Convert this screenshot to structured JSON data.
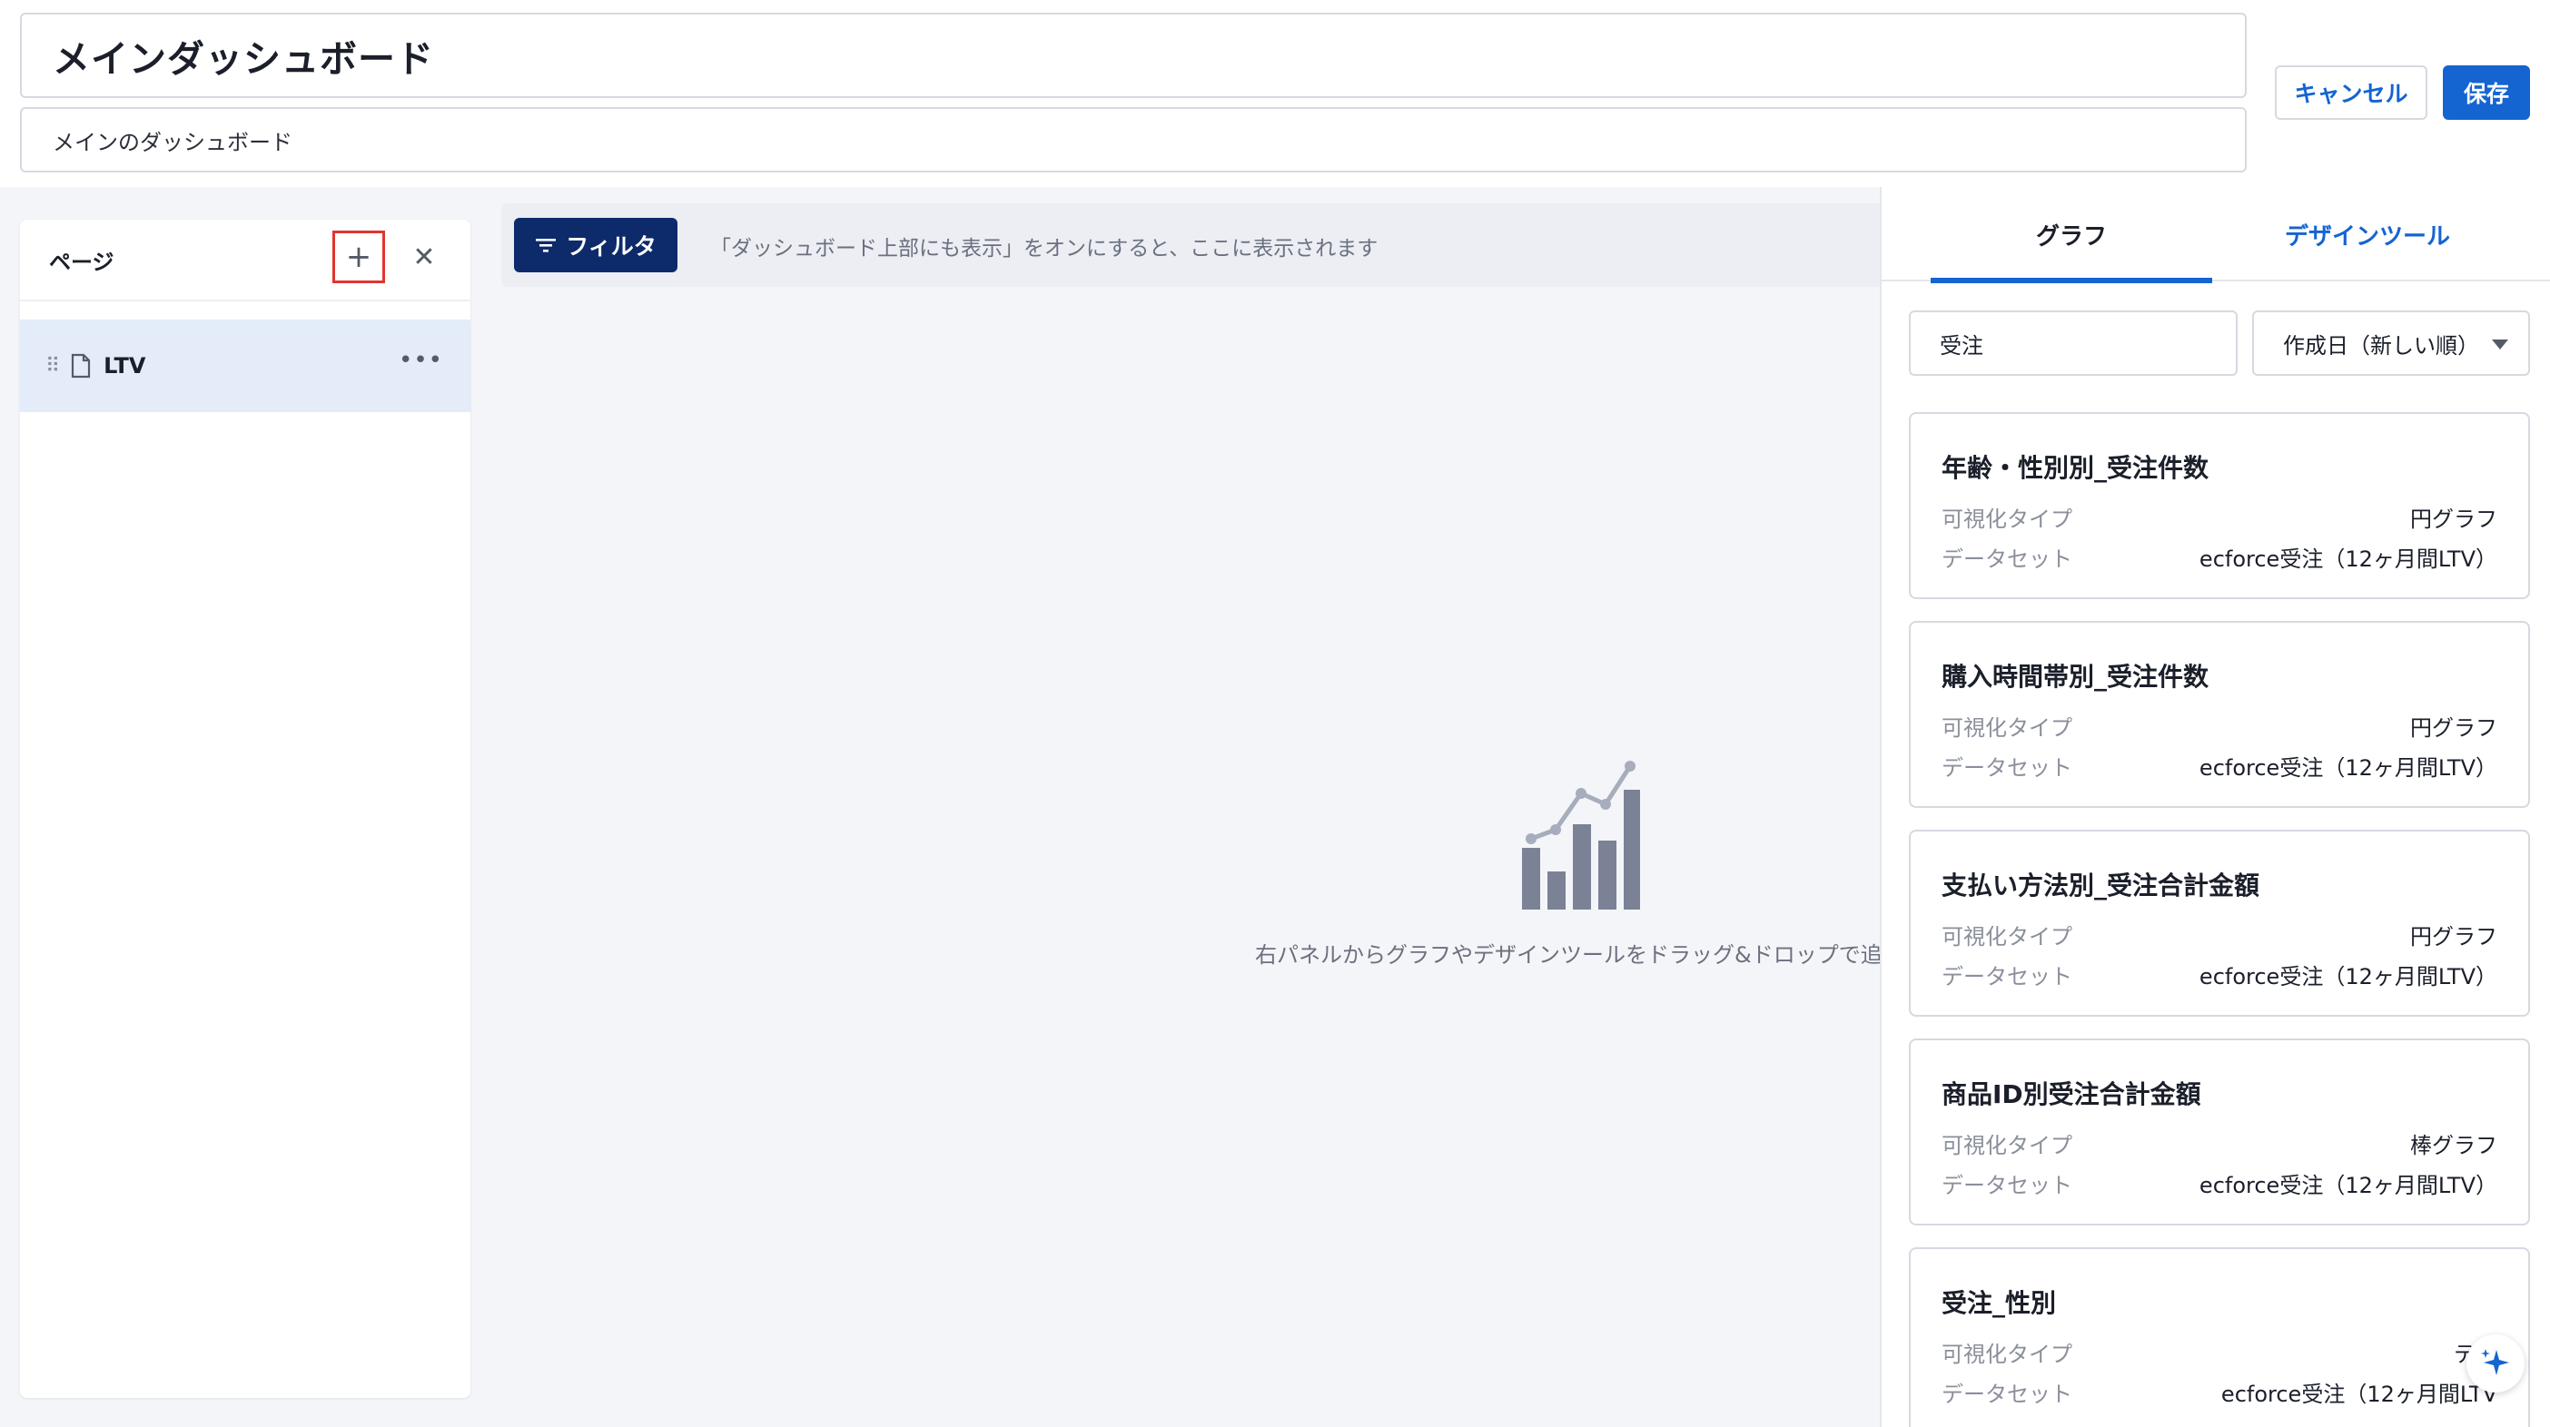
{
  "header": {
    "title": "メインダッシュボード",
    "description": "メインのダッシュボード",
    "cancel_label": "キャンセル",
    "save_label": "保存"
  },
  "pages_panel": {
    "heading": "ページ",
    "add_icon": "plus-icon",
    "close_icon": "close-icon",
    "items": [
      {
        "label": "LTV"
      }
    ]
  },
  "filter": {
    "button_label": "フィルタ",
    "hint": "「ダッシュボード上部にも表示」をオンにすると、ここに表示されます"
  },
  "canvas": {
    "empty_text": "右パネルからグラフやデザインツールをドラッグ&ドロップで追"
  },
  "right_panel": {
    "tabs": [
      {
        "label": "グラフ",
        "active": true
      },
      {
        "label": "デザインツール",
        "active": false
      }
    ],
    "search_value": "受注",
    "sort_value": "作成日（新しい順）",
    "cards": [
      {
        "title": "年齢・性別別_受注件数",
        "type_label": "可視化タイプ",
        "type_value": "円グラフ",
        "dataset_label": "データセット",
        "dataset_value": "ecforce受注（12ヶ月間LTV）"
      },
      {
        "title": "購入時間帯別_受注件数",
        "type_label": "可視化タイプ",
        "type_value": "円グラフ",
        "dataset_label": "データセット",
        "dataset_value": "ecforce受注（12ヶ月間LTV）"
      },
      {
        "title": "支払い方法別_受注合計金額",
        "type_label": "可視化タイプ",
        "type_value": "円グラフ",
        "dataset_label": "データセット",
        "dataset_value": "ecforce受注（12ヶ月間LTV）"
      },
      {
        "title": "商品ID別受注合計金額",
        "type_label": "可視化タイプ",
        "type_value": "棒グラフ",
        "dataset_label": "データセット",
        "dataset_value": "ecforce受注（12ヶ月間LTV）"
      },
      {
        "title": "受注_性別",
        "type_label": "可視化タイプ",
        "type_value": "テー",
        "dataset_label": "データセット",
        "dataset_value": "ecforce受注（12ヶ月間LTV"
      }
    ]
  },
  "colors": {
    "primary": "#1464d2",
    "navy": "#0d2a6b",
    "highlight_border": "#e3342f",
    "selected_row": "#e3ecf8"
  }
}
